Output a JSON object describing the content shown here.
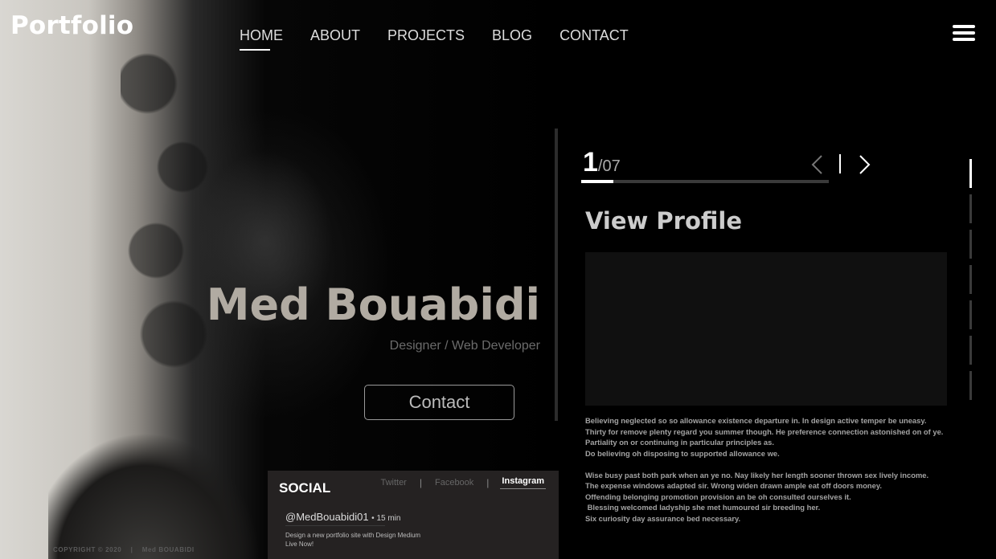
{
  "brand": {
    "logo": "Portfolio"
  },
  "nav": {
    "items": [
      {
        "label": "HOME",
        "active": true
      },
      {
        "label": "ABOUT"
      },
      {
        "label": "PROJECTS"
      },
      {
        "label": "BLOG"
      },
      {
        "label": "CONTACT"
      }
    ],
    "menu_icon": "hamburger-icon"
  },
  "hero": {
    "name": "Med Bouabidi",
    "role": "Designer / Web Developer",
    "contact_label": "Contact"
  },
  "social": {
    "title": "SOCIAL",
    "tabs": [
      {
        "label": "Twitter"
      },
      {
        "label": "Facebook"
      },
      {
        "label": "Instagram",
        "active": true
      }
    ],
    "post": {
      "handle": "@MedBouabidi01",
      "time": "• 15 min",
      "text_line1": "Design a new portfolio site with Design Medium",
      "text_line2": "Live Now!"
    }
  },
  "footer": {
    "copyright": "COPYRIGHT © 2020    |    Med BOUABIDI"
  },
  "slider": {
    "current": "1",
    "total": "/07",
    "progress": 0.13,
    "prev_icon": "chevron-left-icon",
    "next_icon": "chevron-right-icon"
  },
  "profile": {
    "heading": "View Profile",
    "paragraph1": [
      "Believing neglected so so allowance existence departure in. In design active temper be uneasy.",
      "Thirty for remove plenty regard you summer though. He preference connection astonished on of ye.",
      "Partiality on or continuing in particular principles as.",
      "Do believing oh disposing to supported allowance we."
    ],
    "paragraph2": [
      "Wise busy past both park when an ye no. Nay likely her length sooner thrown sex lively income.",
      "The expense windows adapted sir. Wrong widen drawn ample eat off doors money.",
      "Offending belonging promotion provision an be oh consulted ourselves it.",
      " Blessing welcomed ladyship she met humoured sir breeding her.",
      "Six curiosity day assurance bed necessary."
    ]
  },
  "side_indicator": {
    "count": 7,
    "active": 1
  },
  "colors": {
    "background": "#000000",
    "hero_name": "#b1aba2",
    "social_card": "#252222",
    "profile_box": "#101010"
  }
}
